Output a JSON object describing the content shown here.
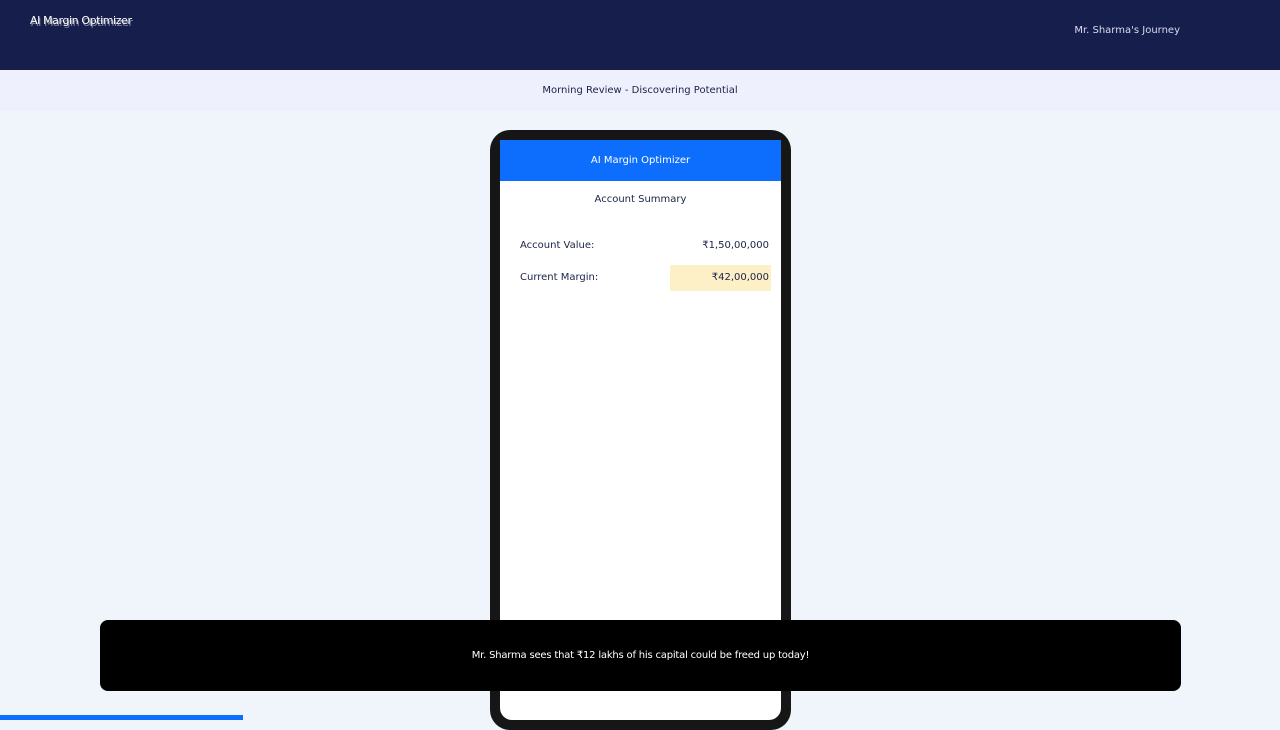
{
  "top_bar": {
    "logo_text": "AI Margin Optimizer",
    "journey_label": "Mr. Sharma's Journey"
  },
  "scene": {
    "title": "Morning Review - Discovering Potential"
  },
  "phone": {
    "app_header": "AI Margin Optimizer",
    "section_title": "Account Summary",
    "rows": [
      {
        "label": "Account Value:",
        "value": "₹1,50,00,000"
      },
      {
        "label": "Current Margin:",
        "value": "₹42,00,000"
      }
    ]
  },
  "caption": {
    "text": "Mr. Sharma sees that ₹12 lakhs of his capital could be freed up today!"
  },
  "progress": {
    "fraction": 0.19
  },
  "colors": {
    "top_bar": "#161f4b",
    "accent": "#0d6efd",
    "highlight": "#fdf0c7",
    "caption_bg": "#000000"
  }
}
